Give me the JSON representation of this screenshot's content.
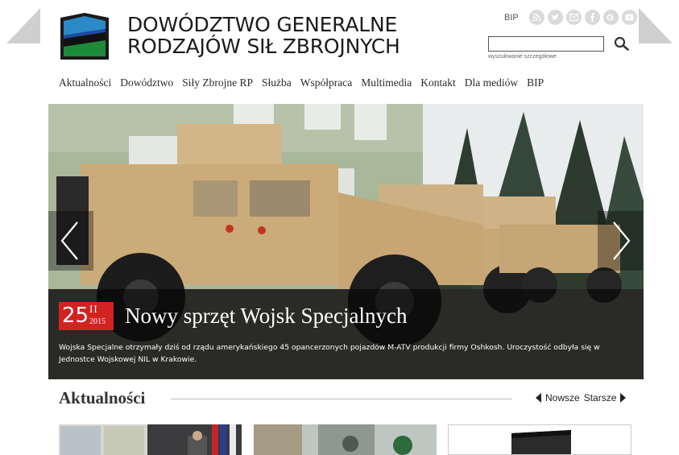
{
  "site": {
    "title_line1": "DOWÓDZTWO GENERALNE",
    "title_line2": "RODZAJÓW SIŁ ZBROJNYCH",
    "bip_label": "BIP",
    "social_icons": [
      "rss-icon",
      "twitter-icon",
      "email-icon",
      "facebook-icon",
      "google-plus-icon",
      "youtube-icon"
    ]
  },
  "search": {
    "value": "",
    "placeholder": "",
    "advanced_label": "wyszukiwanie szczegółowe"
  },
  "nav": {
    "items": [
      "Aktualności",
      "Dowództwo",
      "Siły Zbrojne RP",
      "Służba",
      "Współpraca",
      "Multimedia",
      "Kontakt",
      "Dla mediów",
      "BIP"
    ]
  },
  "slide": {
    "day": "25",
    "month": "II",
    "year": "2015",
    "title": "Nowy sprzęt Wojsk Specjalnych",
    "description": "Wojska Specjalne otrzymały dziś od rządu amerykańskiego 45 opancerzonych pojazdów M-ATV produkcji firmy Oshkosh. Uroczystość odbyła się w Jednostce Wojskowej NIL w Krakowie."
  },
  "news": {
    "section_title": "Aktualności",
    "newer_label": "Nowsze",
    "older_label": "Starsze"
  },
  "colors": {
    "accent_red": "#d32222",
    "nav_text": "#2b2b2b",
    "logo_blue": "#1f4aa8",
    "logo_green": "#1d8a3a"
  }
}
